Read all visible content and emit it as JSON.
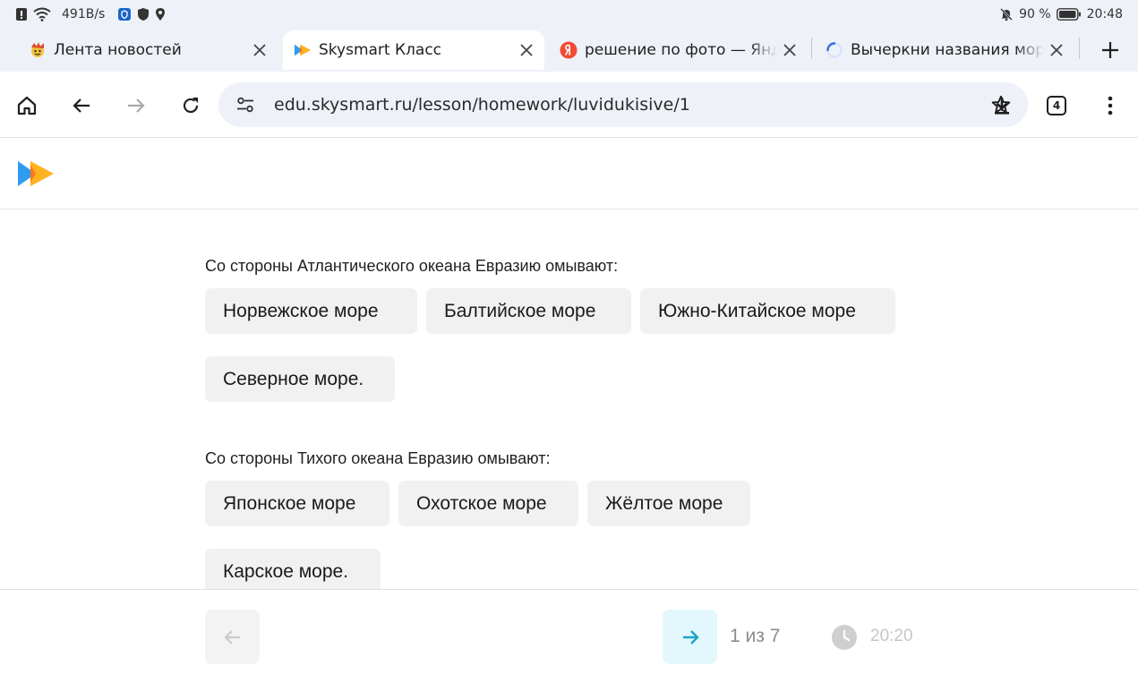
{
  "status_bar": {
    "speed": "491B/s",
    "battery_percent": "90 %",
    "time": "20:48",
    "icons": [
      "alert-icon",
      "wifi-icon",
      "vpn-icon",
      "shield-icon",
      "location-icon",
      "bell-off-icon",
      "battery-icon"
    ]
  },
  "tabs": [
    {
      "title": "Лента новостей",
      "favicon": "news-favicon",
      "active": false
    },
    {
      "title": "Skysmart Класс",
      "favicon": "skysmart-favicon",
      "active": true
    },
    {
      "title": "решение по фото — Яндекс",
      "favicon": "yandex-favicon",
      "active": false
    },
    {
      "title": "Вычеркни названия морей",
      "favicon": "loading-spinner",
      "active": false
    }
  ],
  "toolbar": {
    "url": "edu.skysmart.ru/lesson/homework/luvidukisive/1",
    "tab_count": "4"
  },
  "content": {
    "section_1": {
      "label": "Со стороны Атлантического океана Евразию омывают:",
      "options": [
        "Норвежское море",
        "Балтийское море",
        "Южно-Китайское море",
        "Северное море."
      ]
    },
    "section_2": {
      "label": "Со стороны Тихого океана Евразию омывают:",
      "options": [
        "Японское море",
        "Охотское море",
        "Жёлтое море",
        "Карское море."
      ]
    }
  },
  "footer": {
    "pager": "1 из 7",
    "timer": "20:20"
  },
  "colors": {
    "accent_next": "#1fa3c6",
    "chip_bg": "#f1f1f1",
    "logo_blue": "#2f9cf0",
    "logo_orange": "#ffb21f"
  }
}
